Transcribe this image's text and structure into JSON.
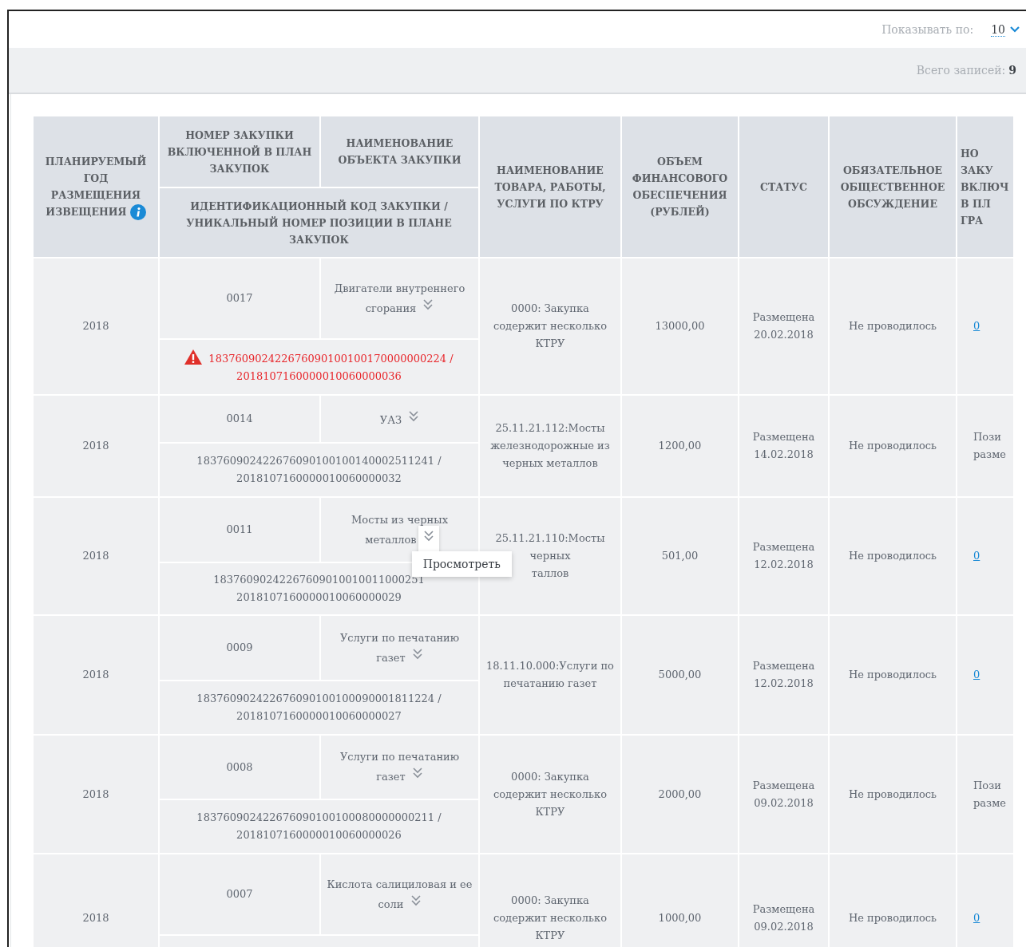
{
  "pager": {
    "label": "Показывать по:",
    "value": "10"
  },
  "total": {
    "label": "Всего записей:",
    "value": "9"
  },
  "header": {
    "year": "ПЛАНИРУЕМЫЙ ГОД РАЗМЕЩЕНИЯ ИЗВЕЩЕНИЯ",
    "number": "НОМЕР ЗАКУПКИ ВКЛЮЧЕННОЙ В ПЛАН ЗАКУПОК",
    "object": "НАИМЕНОВАНИЕ ОБЪЕКТА ЗАКУПКИ",
    "code": "ИДЕНТИФИКАЦИОННЫЙ КОД ЗАКУПКИ / УНИКАЛЬНЫЙ НОМЕР ПОЗИЦИИ В ПЛАНЕ ЗАКУПОК",
    "ktru": "НАИМЕНОВАНИЕ ТОВАРА, РАБОТЫ, УСЛУГИ ПО КТРУ",
    "volume": "ОБЪЕМ ФИНАНСОВОГО ОБЕСПЕЧЕНИЯ (РУБЛЕЙ)",
    "status": "СТАТУС",
    "discussion": "ОБЯЗАТЕЛЬНОЕ ОБЩЕСТВЕННОЕ ОБСУЖДЕНИЕ",
    "column_9": [
      "НО",
      "ЗАКУ",
      "ВКЛЮЧ",
      "В ПЛ",
      "ГРА"
    ]
  },
  "rows": [
    {
      "year": "2018",
      "number": "0017",
      "object": "Двигатели внутреннего сгорания",
      "code": "183760902422676090100100170000000224 / 2018107160000010060000036",
      "warning": true,
      "ktru": "0000: Закупка содержит несколько КТРУ",
      "volume": "13000,00",
      "status": "Размещена 20.02.2018",
      "discussion": "Не проводилось",
      "column_9": {
        "kind": "link",
        "lines": [
          "0"
        ]
      }
    },
    {
      "year": "2018",
      "number": "0014",
      "object": "УАЗ",
      "code": "183760902422676090100100140002511241 / 2018107160000010060000032",
      "warning": false,
      "ktru": "25.11.21.112:Мосты железнодорожные из черных металлов",
      "volume": "1200,00",
      "status": "Размещена 14.02.2018",
      "discussion": "Не проводилось",
      "column_9": {
        "kind": "text",
        "lines": [
          "Пози",
          "разме"
        ]
      }
    },
    {
      "year": "2018",
      "number": "0011",
      "object": "Мосты из черных металлов",
      "code": "18376090242267609010010011000251\n2018107160000010060000029",
      "warning": false,
      "ktru": "25.11.21.110:Мосты\nчерных\nталлов",
      "volume": "501,00",
      "status": "Размещена 12.02.2018",
      "discussion": "Не проводилось",
      "column_9": {
        "kind": "link",
        "lines": [
          "0"
        ]
      },
      "menu": {
        "open": true,
        "item": "Просмотреть"
      }
    },
    {
      "year": "2018",
      "number": "0009",
      "object": "Услуги по печатанию газет",
      "code": "183760902422676090100100090001811224 / 2018107160000010060000027",
      "warning": false,
      "ktru": "18.11.10.000:Услуги по печатанию газет",
      "volume": "5000,00",
      "status": "Размещена 12.02.2018",
      "discussion": "Не проводилось",
      "column_9": {
        "kind": "link",
        "lines": [
          "0"
        ]
      }
    },
    {
      "year": "2018",
      "number": "0008",
      "object": "Услуги по печатанию газет",
      "code": "183760902422676090100100080000000211 / 2018107160000010060000026",
      "warning": false,
      "ktru": "0000: Закупка содержит несколько КТРУ",
      "volume": "2000,00",
      "status": "Размещена 09.02.2018",
      "discussion": "Не проводилось",
      "column_9": {
        "kind": "text",
        "lines": [
          "Пози",
          "разме"
        ]
      }
    },
    {
      "year": "2018",
      "number": "0007",
      "object": "Кислота салициловая и ее соли",
      "ktru": "0000: Закупка содержит несколько КТРУ",
      "volume": "1000,00",
      "status": "Размещена 09.02.2018",
      "discussion": "Не проводилось",
      "column_9": {
        "kind": "link",
        "lines": [
          "0"
        ]
      }
    }
  ]
}
